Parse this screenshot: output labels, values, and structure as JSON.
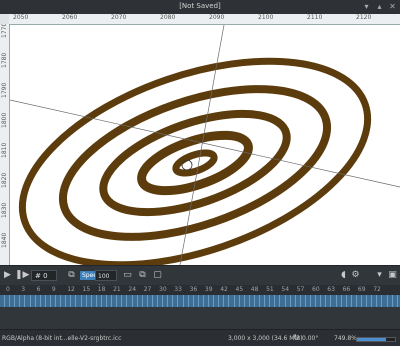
{
  "window": {
    "title": "[Not Saved]",
    "controls": [
      "minimize-icon",
      "maximize-icon",
      "close-icon"
    ]
  },
  "rulers": {
    "top": [
      "2050",
      "2060",
      "2070",
      "2080",
      "2090",
      "2100",
      "2110",
      "2120"
    ],
    "left": [
      "1770",
      "1780",
      "1790",
      "1800",
      "1810",
      "1820",
      "1830",
      "1840"
    ]
  },
  "canvas": {
    "ring_color": "#5c3c0c",
    "background": "#ffffff"
  },
  "toolbar": {
    "frame_value": "0",
    "speed_label": "Speed",
    "speed_value": "100 %"
  },
  "timeline": {
    "frames": [
      "0",
      "3",
      "6",
      "9",
      "12",
      "15",
      "18",
      "21",
      "24",
      "27",
      "30",
      "33",
      "36",
      "39",
      "42",
      "45",
      "48",
      "51",
      "54",
      "57",
      "60",
      "63",
      "66",
      "69",
      "72"
    ]
  },
  "status": {
    "profile": "RGB/Alpha (8-bit int...elle-V2-srgbtrc.icc",
    "size": "3,000 x 3,000 (34.6 MiB)",
    "rotation": "0.00°",
    "zoom": "749.8%",
    "zoom_fraction": 0.75
  },
  "accent": "#3d7fb8"
}
